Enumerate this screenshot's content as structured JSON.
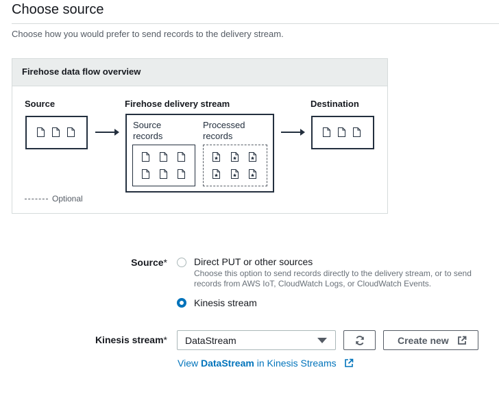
{
  "page": {
    "title": "Choose source",
    "description": "Choose how you would prefer to send records to the delivery stream."
  },
  "overview": {
    "title": "Firehose data flow overview",
    "source_label": "Source",
    "stream_label": "Firehose delivery stream",
    "destination_label": "Destination",
    "source_records_label": "Source\nrecords",
    "processed_records_label": "Processed\nrecords",
    "optional_legend": "Optional",
    "icons": {
      "document": "document-icon",
      "processed_document": "star-document-icon",
      "arrow": "right-arrow-icon"
    }
  },
  "form": {
    "source": {
      "label": "Source",
      "required_mark": "*",
      "options": [
        {
          "label": "Direct PUT or other sources",
          "description": "Choose this option to send records directly to the delivery stream, or to send records from AWS IoT, CloudWatch Logs, or CloudWatch Events.",
          "selected": false
        },
        {
          "label": "Kinesis stream",
          "selected": true
        }
      ]
    },
    "kinesis_stream": {
      "label": "Kinesis stream",
      "required_mark": "*",
      "selected_value": "DataStream",
      "refresh_icon": "refresh-icon",
      "create_label": "Create new",
      "external_icon": "external-link-icon"
    },
    "view_link": {
      "prefix": "View",
      "stream_name": "DataStream",
      "suffix": "in Kinesis Streams"
    }
  },
  "colors": {
    "accent": "#0073bb",
    "dark": "#232f3e",
    "border": "#d5dbdb",
    "header_bg": "#eaeded"
  }
}
